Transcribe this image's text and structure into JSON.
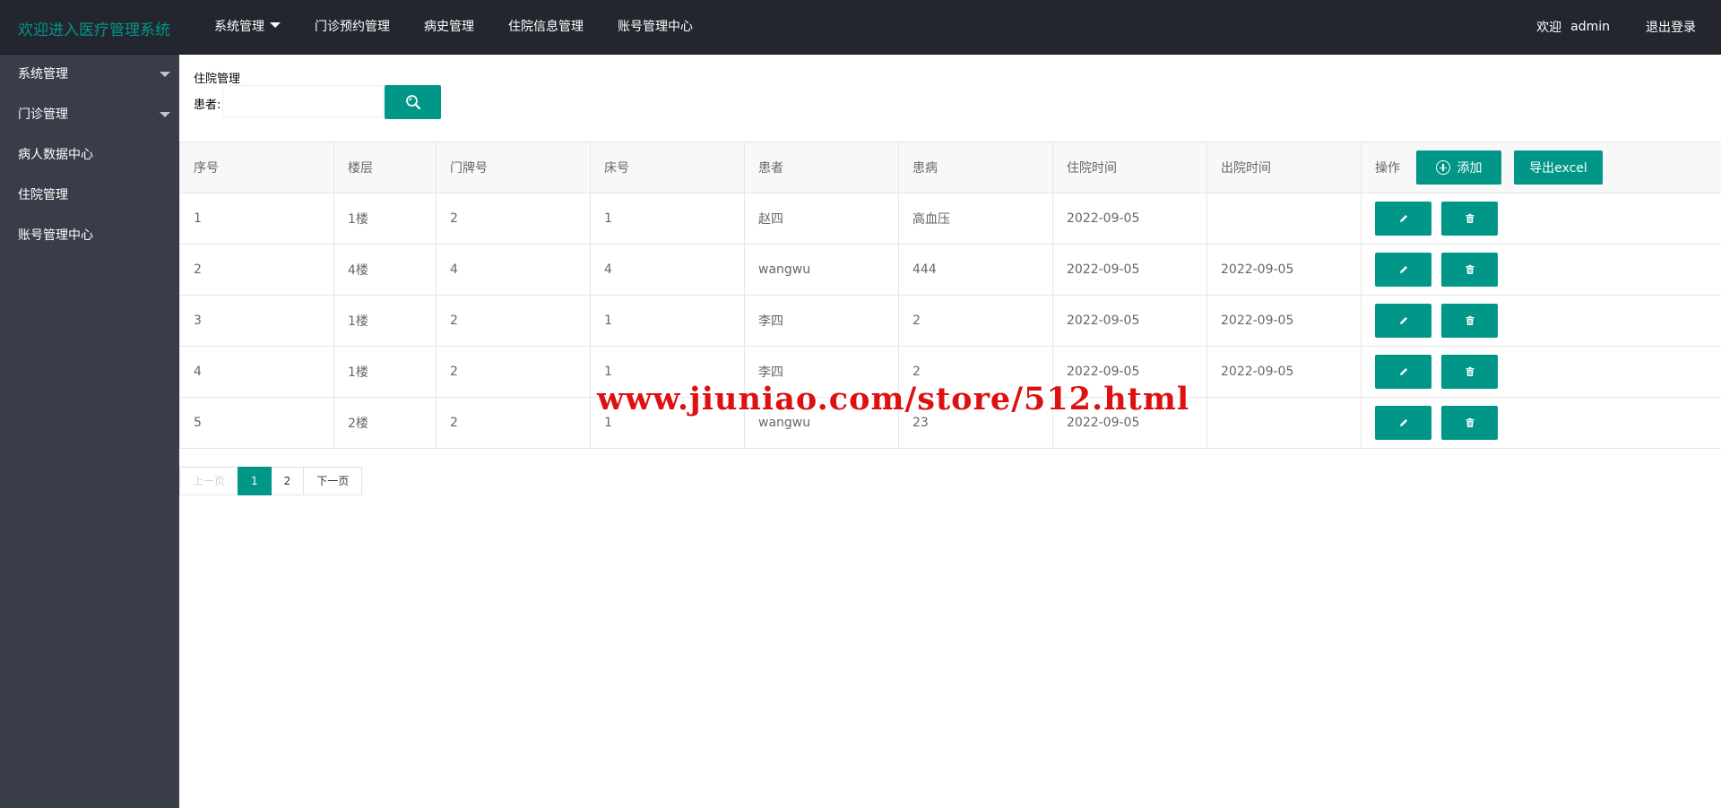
{
  "header": {
    "logo": "欢迎进入医疗管理系统",
    "nav": [
      {
        "label": "系统管理",
        "has_caret": true
      },
      {
        "label": "门诊预约管理"
      },
      {
        "label": "病史管理"
      },
      {
        "label": "住院信息管理"
      },
      {
        "label": "账号管理中心"
      }
    ],
    "welcome": "欢迎",
    "username": "admin",
    "logout": "退出登录"
  },
  "sidebar": {
    "items": [
      {
        "label": "系统管理",
        "has_caret": true
      },
      {
        "label": "门诊管理",
        "has_caret": true
      },
      {
        "label": "病人数据中心"
      },
      {
        "label": "住院管理"
      },
      {
        "label": "账号管理中心"
      }
    ]
  },
  "main": {
    "title": "住院管理",
    "search_label": "患者:",
    "search_value": "",
    "search_icon": "search-icon"
  },
  "table": {
    "headers": [
      "序号",
      "楼层",
      "门牌号",
      "床号",
      "患者",
      "患病",
      "住院时间",
      "出院时间",
      "操作"
    ],
    "add_label": "添加",
    "export_label": "导出excel",
    "rows": [
      [
        "1",
        "1楼",
        "2",
        "1",
        "赵四",
        "高血压",
        "2022-09-05",
        ""
      ],
      [
        "2",
        "4楼",
        "4",
        "4",
        "wangwu",
        "444",
        "2022-09-05",
        "2022-09-05"
      ],
      [
        "3",
        "1楼",
        "2",
        "1",
        "李四",
        "2",
        "2022-09-05",
        "2022-09-05"
      ],
      [
        "4",
        "1楼",
        "2",
        "1",
        "李四",
        "2",
        "2022-09-05",
        "2022-09-05"
      ],
      [
        "5",
        "2楼",
        "2",
        "1",
        "wangwu",
        "23",
        "2022-09-05",
        ""
      ]
    ]
  },
  "pagination": {
    "prev": "上一页",
    "pages": [
      "1",
      "2"
    ],
    "current": "1",
    "next": "下一页"
  },
  "watermark": "www.jiuniao.com/store/512.html",
  "colors": {
    "accent": "#009688",
    "header_bg": "#23262e",
    "sidebar_bg": "#393d49"
  }
}
